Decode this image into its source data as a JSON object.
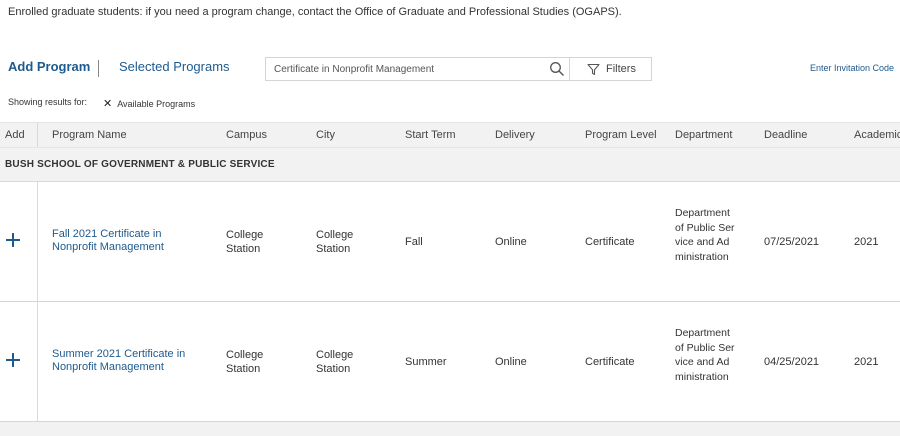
{
  "notice": "Enrolled graduate students: if you need a program change, contact the Office of Graduate and Professional Studies (OGAPS).",
  "tabs": {
    "add_program": "Add Program",
    "selected_programs": "Selected Programs"
  },
  "search": {
    "value": "",
    "placeholder": "Certificate in Nonprofit Management"
  },
  "filters_label": "Filters",
  "invitation_link": "Enter Invitation Code",
  "results": {
    "label": "Showing results for:",
    "chip_label": "Available Programs"
  },
  "table": {
    "headers": [
      "Add",
      "Program Name",
      "Campus",
      "City",
      "Start Term",
      "Delivery",
      "Program Level",
      "Department",
      "Deadline",
      "Academic"
    ],
    "group": "BUSH SCHOOL OF GOVERNMENT & PUBLIC SERVICE",
    "rows": [
      {
        "program_name": "Fall 2021 Certificate in Nonprofit Management",
        "campus": "College Station",
        "city": "College Station",
        "start_term": "Fall",
        "delivery": "Online",
        "level": "Certificate",
        "department": "Department of Public Service and Administration",
        "deadline": "07/25/2021",
        "academic": "2021"
      },
      {
        "program_name": "Summer 2021 Certificate in Nonprofit Management",
        "campus": "College Station",
        "city": "College Station",
        "start_term": "Summer",
        "delivery": "Online",
        "level": "Certificate",
        "department": "Department of Public Service and Administration",
        "deadline": "04/25/2021",
        "academic": "2021"
      }
    ]
  },
  "colors": {
    "link": "#1f5a8e",
    "header_bg": "#f2f2f2",
    "border": "#d5d5d5"
  },
  "icons": {
    "search": "search-icon",
    "filter": "filter-icon",
    "remove": "close-icon",
    "add": "plus-icon"
  }
}
